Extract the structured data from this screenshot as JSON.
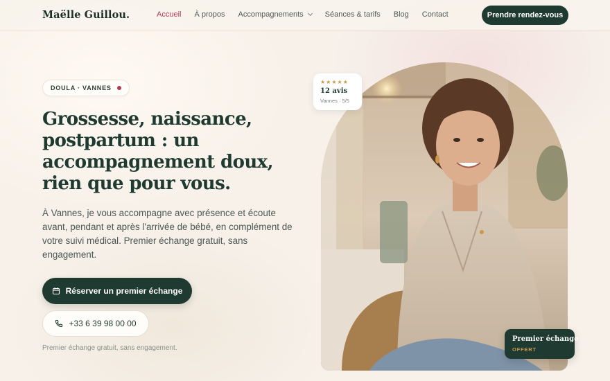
{
  "header": {
    "logo": "Maëlle Guillou.",
    "nav": [
      {
        "label": "Accueil",
        "active": true
      },
      {
        "label": "À propos"
      },
      {
        "label": "Accompagnements",
        "has_dropdown": true
      },
      {
        "label": "Séances & tarifs"
      },
      {
        "label": "Blog"
      },
      {
        "label": "Contact"
      }
    ],
    "cta_label": "Prendre rendez-vous"
  },
  "hero": {
    "tag": "DOULA · VANNES",
    "headline": "Grossesse, naissance, postpartum : un accompagnement doux, rien que pour vous.",
    "lead": "À Vannes, je vous accompagne avec présence et écoute avant, pendant et après l'arrivée de bébé, en complément de votre suivi médical. Premier échange gratuit, sans engagement.",
    "primary_button": {
      "label": "Réserver un premier échange",
      "icon": "calendar-icon"
    },
    "secondary_button": {
      "label": "+33 6 39 98 00 00",
      "icon": "phone-icon"
    },
    "note": "Premier échange gratuit, sans engagement."
  },
  "reviews_badge": {
    "stars": "★★★★★",
    "count": "12 avis",
    "meta": "Vannes · 5/5"
  },
  "offer_badge": {
    "title": "Premier échange",
    "subtitle": "OFFERT"
  },
  "colors": {
    "brand_dark": "#1f3a31",
    "accent_rose": "#b43a54",
    "star_gold": "#c79a4a",
    "background": "#f7f1ea"
  }
}
